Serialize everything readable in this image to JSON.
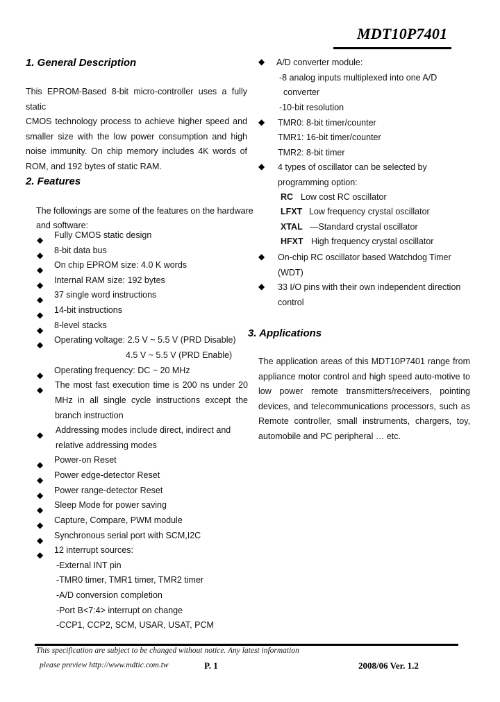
{
  "header": {
    "title": "MDT10P7401"
  },
  "general": {
    "heading": "1. General Description",
    "lines": [
      "This EPROM-Based 8-bit micro-controller uses a fully static",
      "CMOS technology process to achieve higher speed and",
      "smaller size with the low power consumption and high",
      "noise immunity. On chip memory includes 4K words of",
      "ROM, and 192 bytes of static RAM."
    ]
  },
  "features": {
    "heading": "2. Features",
    "intro": [
      "The followings are some of the features on the hardware",
      "and software:"
    ],
    "bullet_glyph": "◆",
    "items": [
      "Fully CMOS static design",
      "8-bit data bus",
      "On chip EPROM size: 4.0 K words",
      "Internal RAM size: 192 bytes",
      "37 single word instructions",
      "14-bit instructions",
      "8-level stacks",
      "Operating voltage: 2.5 V ~ 5.5 V (PRD Disable)",
      "4.5 V ~ 5.5 V (PRD Enable)",
      "Operating frequency: DC ~ 20 MHz",
      "The most fast execution time is 200 ns under 20",
      "MHz in all single cycle instructions except the",
      "branch instruction",
      "Addressing modes include direct, indirect and",
      "relative addressing modes",
      "Power-on Reset",
      "Power edge-detector Reset",
      "Power range-detector Reset",
      "Sleep Mode for power saving",
      "Capture, Compare, PWM module",
      "Synchronous serial port with SCM,I2C",
      "12 interrupt sources:",
      "-External INT pin",
      "-TMR0 timer, TMR1 timer, TMR2 timer",
      "-A/D conversion completion",
      "-Port B<7:4> interrupt on change",
      "-CCP1, CCP2, SCM, USAR, USAT, PCM"
    ],
    "right_items": [
      "A/D converter module:",
      "-8 analog inputs multiplexed into one A/D",
      "converter",
      "-10-bit resolution",
      "TMR0: 8-bit timer/counter",
      "TMR1: 16-bit timer/counter",
      "TMR2: 8-bit timer",
      "4 types of oscillator can be selected by",
      "programming option:",
      "RC",
      "Low cost RC oscillator",
      "LFXT",
      "Low frequency crystal oscillator",
      "XTAL",
      "—Standard crystal oscillator",
      "HFXT",
      "High frequency crystal oscillator",
      "On-chip RC oscillator based Watchdog Timer",
      "(WDT)",
      "33 I/O pins with their own independent direction",
      "control"
    ]
  },
  "applications": {
    "heading": "3. Applications",
    "lines": [
      "The application areas of this MDT10P7401 range from",
      "appliance motor control and high speed auto-motive to",
      "low power remote transmitters/receivers, pointing",
      "devices, and telecommunications processors, such as",
      "Remote controller, small instruments, chargers, toy,",
      "automobile and PC peripheral … etc."
    ]
  },
  "footer": {
    "notice": "This specification are subject to be changed without notice. Any latest information",
    "preview": "please preview http://www.mdtic.com.tw",
    "page": "P. 1",
    "version": "2008/06 Ver. 1.2"
  }
}
